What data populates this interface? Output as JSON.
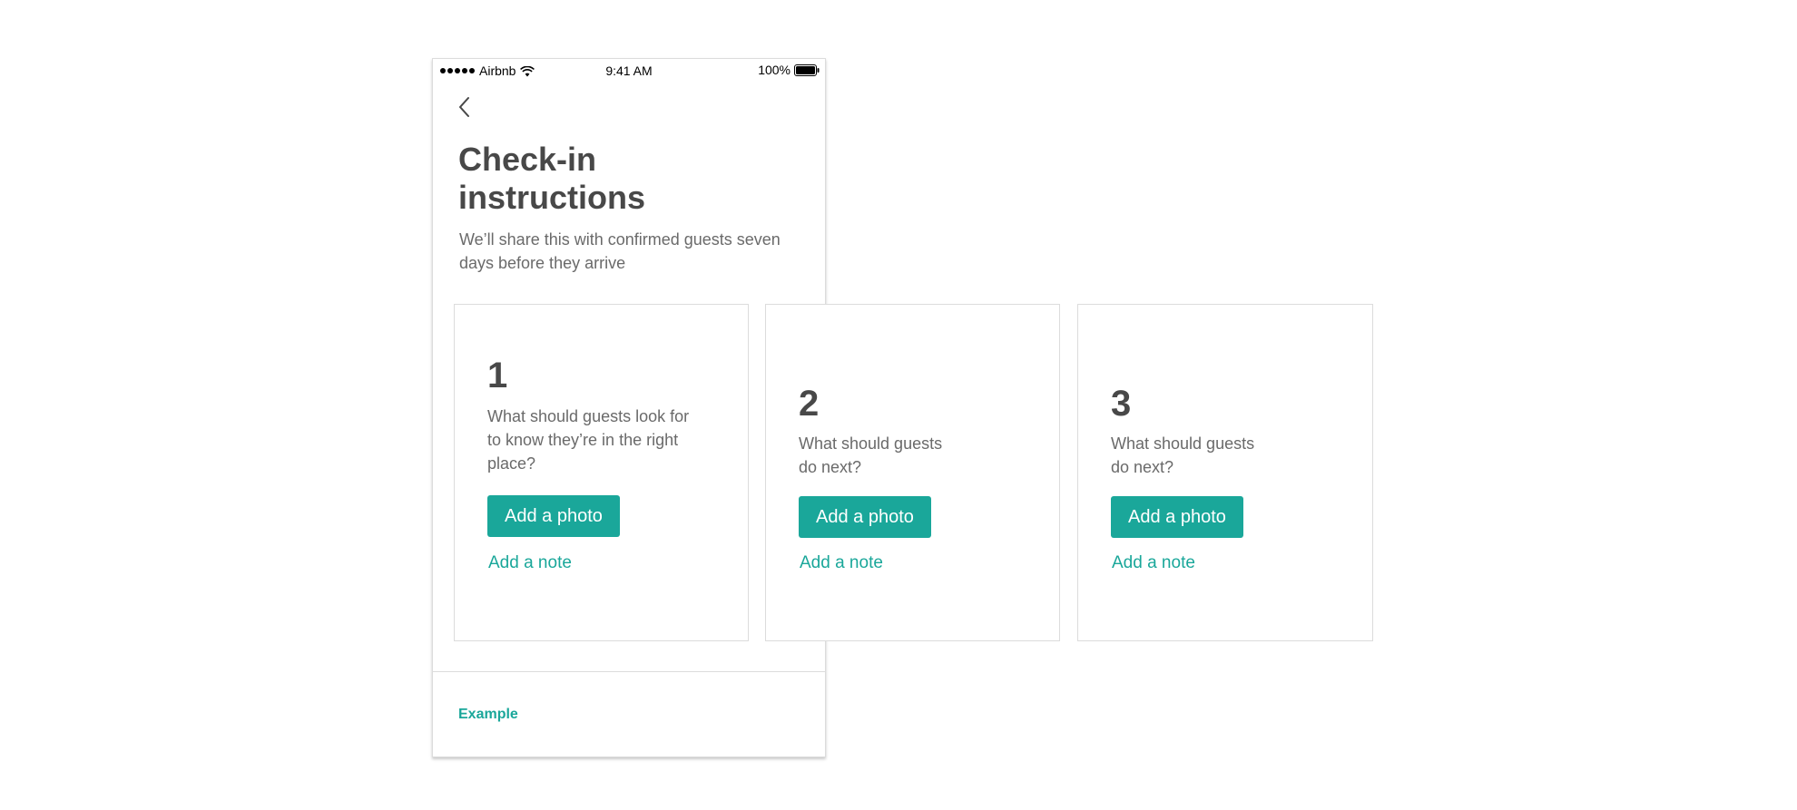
{
  "status_bar": {
    "carrier": "Airbnb",
    "time": "9:41 AM",
    "battery": "100%",
    "icons": [
      "signal-dots-icon",
      "wifi-icon",
      "battery-icon"
    ]
  },
  "header": {
    "back_icon": "chevron-left-icon",
    "title": "Check-in instructions",
    "subtitle": "We’ll share this with confirmed guests seven days before they arrive"
  },
  "cards": [
    {
      "number": "1",
      "question": "What should guests look for to know they’re in the right place?",
      "photo_button": "Add a photo",
      "note_link": "Add a note"
    },
    {
      "number": "2",
      "question": "What should guests do next?",
      "photo_button": "Add a photo",
      "note_link": "Add a note"
    },
    {
      "number": "3",
      "question": "What should guests do next?",
      "photo_button": "Add a photo",
      "note_link": "Add a note"
    }
  ],
  "footer": {
    "example_link": "Example"
  },
  "colors": {
    "accent": "#1aa79a",
    "text_dark": "#484848",
    "text_muted": "#6a6a6a",
    "border": "#dcdcdc"
  }
}
